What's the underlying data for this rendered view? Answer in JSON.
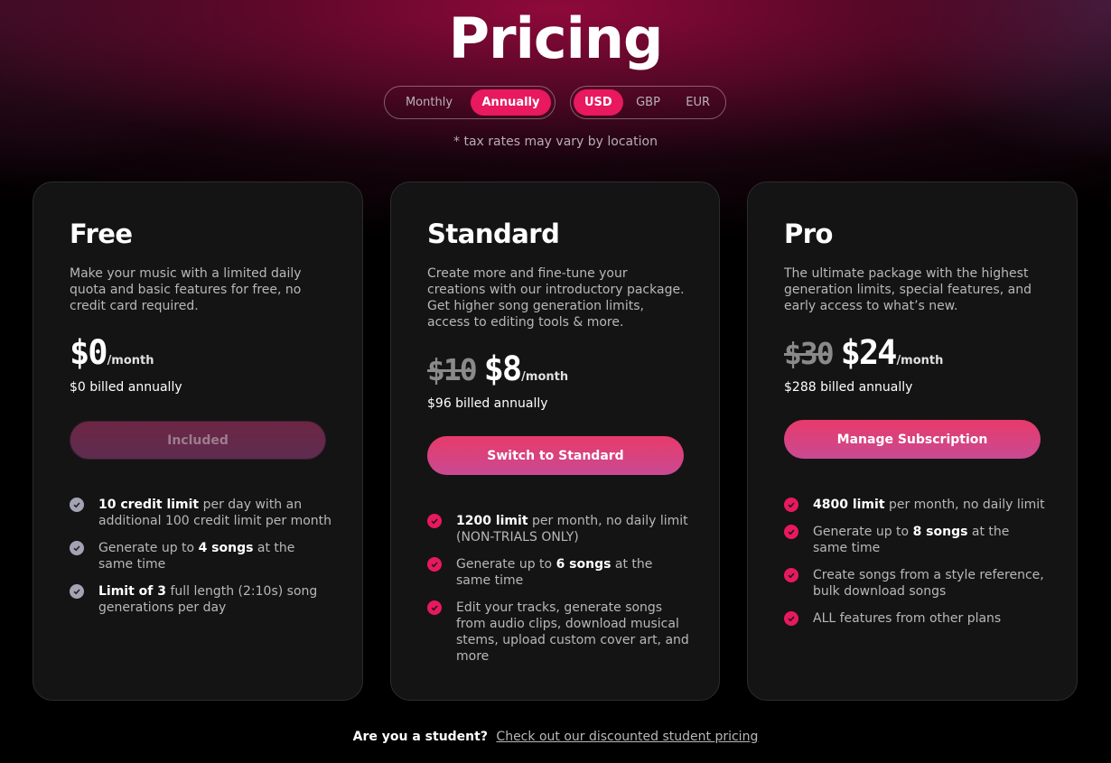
{
  "header": {
    "title": "Pricing",
    "billing_options": [
      "Monthly",
      "Annually"
    ],
    "billing_selected": "Annually",
    "currency_options": [
      "USD",
      "GBP",
      "EUR"
    ],
    "currency_selected": "USD",
    "tax_note": "* tax rates may vary by location"
  },
  "colors": {
    "accent": "#e8195e",
    "card_bg": "#141414",
    "muted_check": "#a3a3b3"
  },
  "plans": [
    {
      "name": "Free",
      "description": "Make your music with a limited daily quota and basic features for free, no credit card required.",
      "price": "$0",
      "unit": "/month",
      "billed": "$0 billed annually",
      "button": "Included",
      "button_state": "disabled",
      "features": [
        {
          "bold": "10 credit limit",
          "rest": " per day with an additional 100 credit limit per month"
        },
        {
          "pre": "Generate up to ",
          "bold": "4 songs",
          "rest": " at the same time"
        },
        {
          "bold": "Limit of 3",
          "rest": " full length (2:10s) song generations per day"
        }
      ]
    },
    {
      "name": "Standard",
      "description": "Create more and fine-tune your creations with our introductory package. Get higher song generation limits, access to editing tools & more.",
      "old_price": "$10",
      "price": "$8",
      "unit": "/month",
      "billed": "$96 billed annually",
      "button": "Switch to Standard",
      "features": [
        {
          "bold": "1200 limit",
          "rest": " per month, no daily limit (NON-TRIALS ONLY)"
        },
        {
          "pre": "Generate up to ",
          "bold": "6 songs",
          "rest": " at the same time"
        },
        {
          "rest": "Edit your tracks, generate songs from audio clips, download musical stems, upload custom cover art, and more"
        }
      ]
    },
    {
      "name": "Pro",
      "description": "The ultimate package with the highest generation limits, special features, and early access to what’s new.",
      "old_price": "$30",
      "price": "$24",
      "unit": "/month",
      "billed": "$288 billed annually",
      "button": "Manage Subscription",
      "features": [
        {
          "bold": "4800 limit",
          "rest": " per month, no daily limit"
        },
        {
          "pre": "Generate up to ",
          "bold": "8 songs",
          "rest": " at the same time"
        },
        {
          "rest": "Create songs from a style reference, bulk download songs"
        },
        {
          "rest": "ALL features from other plans"
        }
      ]
    }
  ],
  "footer": {
    "question": "Are you a student?",
    "link": "Check out our discounted student pricing"
  }
}
